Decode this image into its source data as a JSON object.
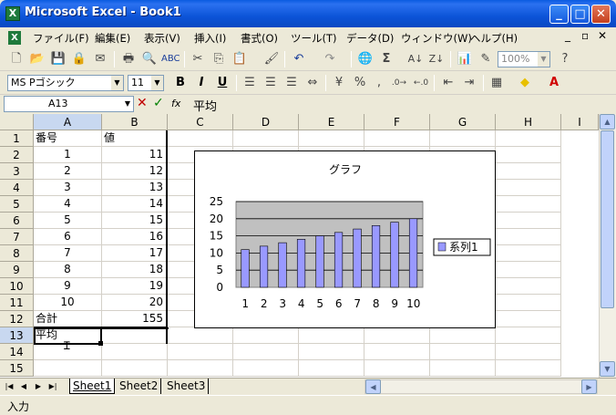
{
  "window": {
    "title": "Microsoft Excel - Book1",
    "app_icon": "excel-icon"
  },
  "menu": [
    "ファイル(F)",
    "編集(E)",
    "表示(V)",
    "挿入(I)",
    "書式(O)",
    "ツール(T)",
    "データ(D)",
    "ウィンドウ(W)",
    "ヘルプ(H)"
  ],
  "standard_toolbar": {
    "zoom": "100%"
  },
  "format_toolbar": {
    "font": "MS Pゴシック",
    "size": "11",
    "bold": "B",
    "italic": "I",
    "underline": "U"
  },
  "formula_bar": {
    "name_box": "A13",
    "fx": "fx",
    "value": "平均"
  },
  "columns": [
    "A",
    "B",
    "C",
    "D",
    "E",
    "F",
    "G",
    "H",
    "I"
  ],
  "rows": [
    "1",
    "2",
    "3",
    "4",
    "5",
    "6",
    "7",
    "8",
    "9",
    "10",
    "11",
    "12",
    "13",
    "14",
    "15"
  ],
  "cells": {
    "header_a": "番号",
    "header_b": "値",
    "a": [
      "1",
      "2",
      "3",
      "4",
      "5",
      "6",
      "7",
      "8",
      "9",
      "10"
    ],
    "b": [
      "11",
      "12",
      "13",
      "14",
      "15",
      "16",
      "17",
      "18",
      "19",
      "20"
    ],
    "total_label": "合計",
    "total_value": "155",
    "avg_label": "平均"
  },
  "chart_data": {
    "type": "bar",
    "title": "グラフ",
    "categories": [
      "1",
      "2",
      "3",
      "4",
      "5",
      "6",
      "7",
      "8",
      "9",
      "10"
    ],
    "series": [
      {
        "name": "系列1",
        "values": [
          11,
          12,
          13,
          14,
          15,
          16,
          17,
          18,
          19,
          20
        ],
        "color": "#9999ff"
      }
    ],
    "yticks": [
      "0",
      "5",
      "10",
      "15",
      "20",
      "25"
    ],
    "ylim": [
      0,
      25
    ],
    "grid": true,
    "legend": "right"
  },
  "sheets": [
    "Sheet1",
    "Sheet2",
    "Sheet3"
  ],
  "status": "入力"
}
